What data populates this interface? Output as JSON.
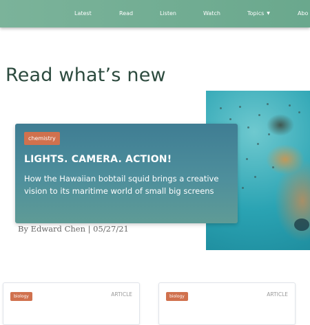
{
  "nav": {
    "items": [
      "Latest",
      "Read",
      "Listen",
      "Watch",
      "Topics",
      "Abo"
    ],
    "background": "#6fab91"
  },
  "page": {
    "title": "Read what’s new"
  },
  "featured": {
    "tag": "chemistry",
    "headline": "LIGHTS. CAMERA. ACTION!",
    "summary": "How the Hawaiian bobtail squid brings a creative vision to its maritime world of small big screens",
    "byline": "By Edward Chen | 05/27/21",
    "image": "squid-photo",
    "card_color": "#4b8a9a",
    "tag_color": "#d0714e"
  },
  "articles": [
    {
      "tag": "biology",
      "type": "ARTICLE"
    },
    {
      "tag": "biology",
      "type": "ARTICLE"
    }
  ]
}
